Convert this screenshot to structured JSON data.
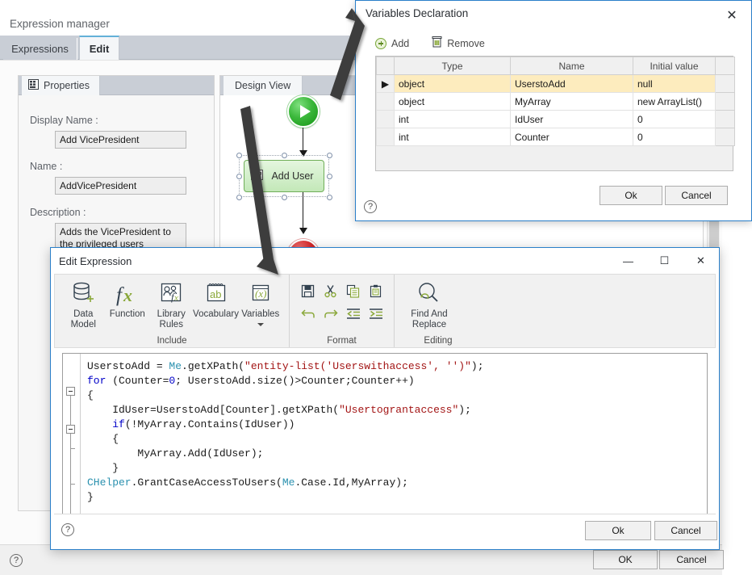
{
  "background_window": {
    "title": "Expression manager",
    "tabs": [
      {
        "label": "Expressions",
        "active": false
      },
      {
        "label": "Edit",
        "active": true
      }
    ],
    "properties_pane": {
      "tab_label": "Properties",
      "tab_icon": "grid-icon",
      "fields": [
        {
          "label": "Display Name :",
          "value": "Add VicePresident"
        },
        {
          "label": "Name :",
          "value": "AddVicePresident"
        },
        {
          "label": "Description :",
          "value": "Adds the VicePresident to the privileged users"
        }
      ]
    },
    "design_pane": {
      "tab_label": "Design View",
      "nodes": [
        {
          "type": "start",
          "label": ""
        },
        {
          "type": "activity",
          "label": "Add User"
        },
        {
          "type": "stop",
          "label": ""
        }
      ]
    },
    "footer": {
      "help_label": "?",
      "ok_label": "OK",
      "cancel_label": "Cancel"
    }
  },
  "variables_dialog": {
    "title": "Variables Declaration",
    "close_label": "✕",
    "toolbar": {
      "add_label": "Add",
      "remove_label": "Remove"
    },
    "table": {
      "columns": [
        "Type",
        "Name",
        "Initial value"
      ],
      "rows": [
        {
          "selected": true,
          "marker": "▶",
          "type": "object",
          "name": "UserstoAdd",
          "initial_value": "null"
        },
        {
          "selected": false,
          "marker": "",
          "type": "object",
          "name": "MyArray",
          "initial_value": "new ArrayList()"
        },
        {
          "selected": false,
          "marker": "",
          "type": "int",
          "name": "IdUser",
          "initial_value": "0"
        },
        {
          "selected": false,
          "marker": "",
          "type": "int",
          "name": "Counter",
          "initial_value": "0"
        }
      ]
    },
    "footer": {
      "help_label": "?",
      "ok_label": "Ok",
      "cancel_label": "Cancel"
    }
  },
  "edit_expression_window": {
    "title": "Edit Expression",
    "window_buttons": {
      "minimize": "—",
      "maximize": "☐",
      "close": "✕"
    },
    "ribbon": {
      "groups": [
        {
          "title": "Include",
          "buttons": [
            {
              "label": "Data Model",
              "icon": "database-add-icon",
              "has_caret": false
            },
            {
              "label": "Function",
              "icon": "fx-icon",
              "has_caret": false
            },
            {
              "label": "Library Rules",
              "icon": "library-rules-icon",
              "has_caret": false
            },
            {
              "label": "Vocabulary",
              "icon": "vocabulary-ab-icon",
              "has_caret": false
            },
            {
              "label": "Variables",
              "icon": "variables-x-icon",
              "has_caret": true
            }
          ]
        },
        {
          "title": "Format",
          "small_buttons": [
            {
              "icon": "save-icon"
            },
            {
              "icon": "cut-icon"
            },
            {
              "icon": "copy-icon"
            },
            {
              "icon": "paste-icon"
            },
            {
              "icon": "undo-icon"
            },
            {
              "icon": "redo-icon"
            },
            {
              "icon": "decrease-indent-icon"
            },
            {
              "icon": "increase-indent-icon"
            }
          ]
        },
        {
          "title": "Editing",
          "buttons": [
            {
              "label": "Find And Replace",
              "icon": "find-replace-icon",
              "has_caret": false
            }
          ]
        }
      ]
    },
    "code_lines": [
      [
        {
          "t": "UserstoAdd = ",
          "c": "p"
        },
        {
          "t": "Me",
          "c": "t"
        },
        {
          "t": ".getXPath(",
          "c": "p"
        },
        {
          "t": "\"entity-list('Userswithaccess', '')\"",
          "c": "s"
        },
        {
          "t": ");",
          "c": "p"
        }
      ],
      [
        {
          "t": "for",
          "c": "k"
        },
        {
          "t": " (Counter=",
          "c": "p"
        },
        {
          "t": "0",
          "c": "n"
        },
        {
          "t": "; UserstoAdd.size()>Counter;Counter++)",
          "c": "p"
        }
      ],
      [
        {
          "t": "{",
          "c": "p"
        }
      ],
      [
        {
          "t": "    IdUser=UserstoAdd[Counter].getXPath(",
          "c": "p"
        },
        {
          "t": "\"Usertograntaccess\"",
          "c": "s"
        },
        {
          "t": ");",
          "c": "p"
        }
      ],
      [
        {
          "t": "    ",
          "c": "p"
        },
        {
          "t": "if",
          "c": "k"
        },
        {
          "t": "(!MyArray.Contains(IdUser))",
          "c": "p"
        }
      ],
      [
        {
          "t": "    {",
          "c": "p"
        }
      ],
      [
        {
          "t": "        MyArray.Add(IdUser);",
          "c": "p"
        }
      ],
      [
        {
          "t": "    }",
          "c": "p"
        }
      ],
      [
        {
          "t": "CHelper",
          "c": "t"
        },
        {
          "t": ".GrantCaseAccessToUsers(",
          "c": "p"
        },
        {
          "t": "Me",
          "c": "t"
        },
        {
          "t": ".Case.Id,MyArray);",
          "c": "p"
        }
      ],
      [
        {
          "t": "}",
          "c": "p"
        }
      ]
    ],
    "footer": {
      "help_label": "?",
      "ok_label": "Ok",
      "cancel_label": "Cancel"
    }
  }
}
